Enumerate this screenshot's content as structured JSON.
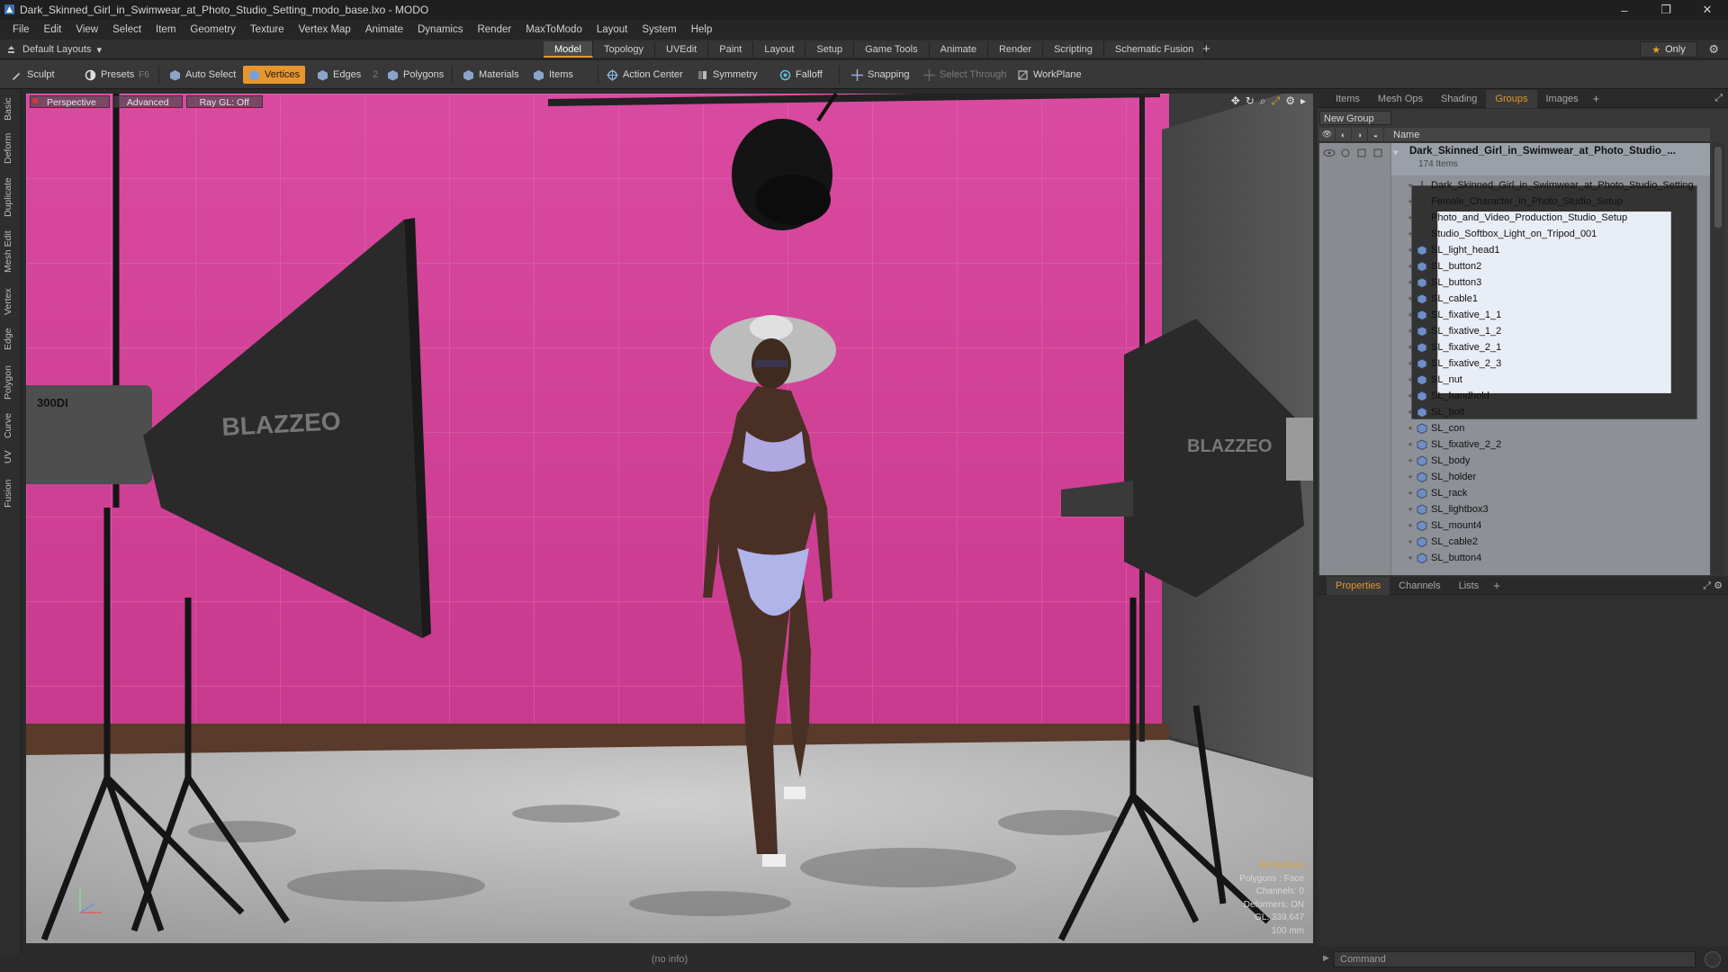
{
  "window": {
    "title": "Dark_Skinned_Girl_in_Swimwear_at_Photo_Studio_Setting_modo_base.lxo - MODO",
    "controls": [
      "–",
      "❐",
      "✕"
    ]
  },
  "menu": [
    "File",
    "Edit",
    "View",
    "Select",
    "Item",
    "Geometry",
    "Texture",
    "Vertex Map",
    "Animate",
    "Dynamics",
    "Render",
    "MaxToModo",
    "Layout",
    "System",
    "Help"
  ],
  "layouts": {
    "selector": "Default Layouts",
    "tabs": [
      "Model",
      "Topology",
      "UVEdit",
      "Paint",
      "Layout",
      "Setup",
      "Game Tools",
      "Animate",
      "Render",
      "Scripting",
      "Schematic Fusion"
    ],
    "active_tab": "Model",
    "only_label": "Only"
  },
  "toolbar": {
    "sculpt": "Sculpt",
    "presets": "Presets",
    "presets_key": "F6",
    "auto_select": "Auto Select",
    "vertices": "Vertices",
    "edges": "Edges",
    "edges_count": "2",
    "polygons": "Polygons",
    "materials": "Materials",
    "items": "Items",
    "action_center": "Action Center",
    "symmetry": "Symmetry",
    "falloff": "Falloff",
    "snapping": "Snapping",
    "select_through": "Select Through",
    "workplane": "WorkPlane"
  },
  "left_tabs": [
    "Basic",
    "Deform",
    "Duplicate",
    "Mesh Edit",
    "Vertex",
    "Edge",
    "Polygon",
    "Curve",
    "UV",
    "Fusion"
  ],
  "viewport": {
    "view": "Perspective",
    "shading": "Advanced",
    "raygl": "Ray GL: Off",
    "softbox_text": "BLAZZEO",
    "strobe_text": "300DI",
    "info": {
      "selection": "All Vertices",
      "polygons": "Polygons : Face",
      "channels": "Channels: 0",
      "deformers": "Deformers: ON",
      "gl": "GL: 339,647",
      "scale": "100 mm"
    }
  },
  "status": {
    "text": "(no info)"
  },
  "right_panel": {
    "top_tabs": [
      "Items",
      "Mesh Ops",
      "Shading",
      "Groups",
      "Images"
    ],
    "active_top_tab": "Groups",
    "new_group": "New Group",
    "column_name": "Name",
    "root": {
      "name": "Dark_Skinned_Girl_in_Swimwear_at_Photo_Studio_...",
      "count": "174 Items"
    },
    "items": [
      {
        "name": "Dark_Skinned_Girl_in_Swimwear_at_Photo_Studio_Setting",
        "type": "locator"
      },
      {
        "name": "Female_Character_in_Photo_Studio_Setup",
        "type": "locator"
      },
      {
        "name": "Photo_and_Video_Production_Studio_Setup",
        "type": "locator"
      },
      {
        "name": "Studio_Softbox_Light_on_Tripod_001",
        "type": "locator"
      },
      {
        "name": "SL_light_head1",
        "type": "mesh"
      },
      {
        "name": "SL_button2",
        "type": "mesh"
      },
      {
        "name": "SL_button3",
        "type": "mesh"
      },
      {
        "name": "SL_cable1",
        "type": "mesh"
      },
      {
        "name": "SL_fixative_1_1",
        "type": "mesh"
      },
      {
        "name": "SL_fixative_1_2",
        "type": "mesh"
      },
      {
        "name": "SL_fixative_2_1",
        "type": "mesh"
      },
      {
        "name": "SL_fixative_2_3",
        "type": "mesh"
      },
      {
        "name": "SL_nut",
        "type": "mesh"
      },
      {
        "name": "SL_handhold",
        "type": "mesh"
      },
      {
        "name": "SL_bolt",
        "type": "mesh"
      },
      {
        "name": "SL_con",
        "type": "mesh"
      },
      {
        "name": "SL_fixative_2_2",
        "type": "mesh"
      },
      {
        "name": "SL_body",
        "type": "mesh"
      },
      {
        "name": "SL_holder",
        "type": "mesh"
      },
      {
        "name": "SL_rack",
        "type": "mesh"
      },
      {
        "name": "SL_lightbox3",
        "type": "mesh"
      },
      {
        "name": "SL_mount4",
        "type": "mesh"
      },
      {
        "name": "SL_cable2",
        "type": "mesh"
      },
      {
        "name": "SL_button4",
        "type": "mesh"
      }
    ],
    "bottom_tabs": [
      "Properties",
      "Channels",
      "Lists"
    ],
    "active_bottom_tab": "Properties",
    "command_placeholder": "Command"
  },
  "colors": {
    "accent": "#e3962b",
    "wall": "#d6479a",
    "floor": "#b9b9b9"
  }
}
